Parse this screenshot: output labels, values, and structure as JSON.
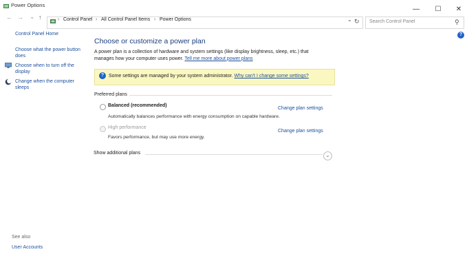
{
  "window": {
    "title": "Power Options",
    "minimize": "—",
    "maximize": "☐",
    "close": "✕"
  },
  "nav": {
    "back": "←",
    "forward": "→",
    "recent": "⌄",
    "up": "↑",
    "breadcrumb": [
      "Control Panel",
      "All Control Panel Items",
      "Power Options"
    ],
    "separator": "›",
    "dropdown": "⌄",
    "refresh": "↻",
    "search_placeholder": "Search Control Panel",
    "search_icon": "⚲"
  },
  "help": {
    "icon": "?"
  },
  "sidebar": {
    "home": "Control Panel Home",
    "links": [
      "Choose what the power button does",
      "Choose when to turn off the display",
      "Change when the computer sleeps"
    ],
    "see_also": "See also",
    "user_accounts": "User Accounts"
  },
  "main": {
    "title": "Choose or customize a power plan",
    "intro": "A power plan is a collection of hardware and system settings (like display brightness, sleep, etc.) that manages how your computer uses power.",
    "intro_link": "Tell me more about power plans",
    "notice_text": "Some settings are managed by your system administrator.",
    "notice_link": "Why can't I change some settings?",
    "preferred_plans": "Preferred plans",
    "plans": [
      {
        "name": "Balanced (recommended)",
        "desc": "Automatically balances performance with energy consumption on capable hardware.",
        "link": "Change plan settings"
      },
      {
        "name": "High performance",
        "desc": "Favors performance, but may use more energy.",
        "link": "Change plan settings"
      }
    ],
    "show_additional": "Show additional plans",
    "expand_icon": "⌄"
  }
}
